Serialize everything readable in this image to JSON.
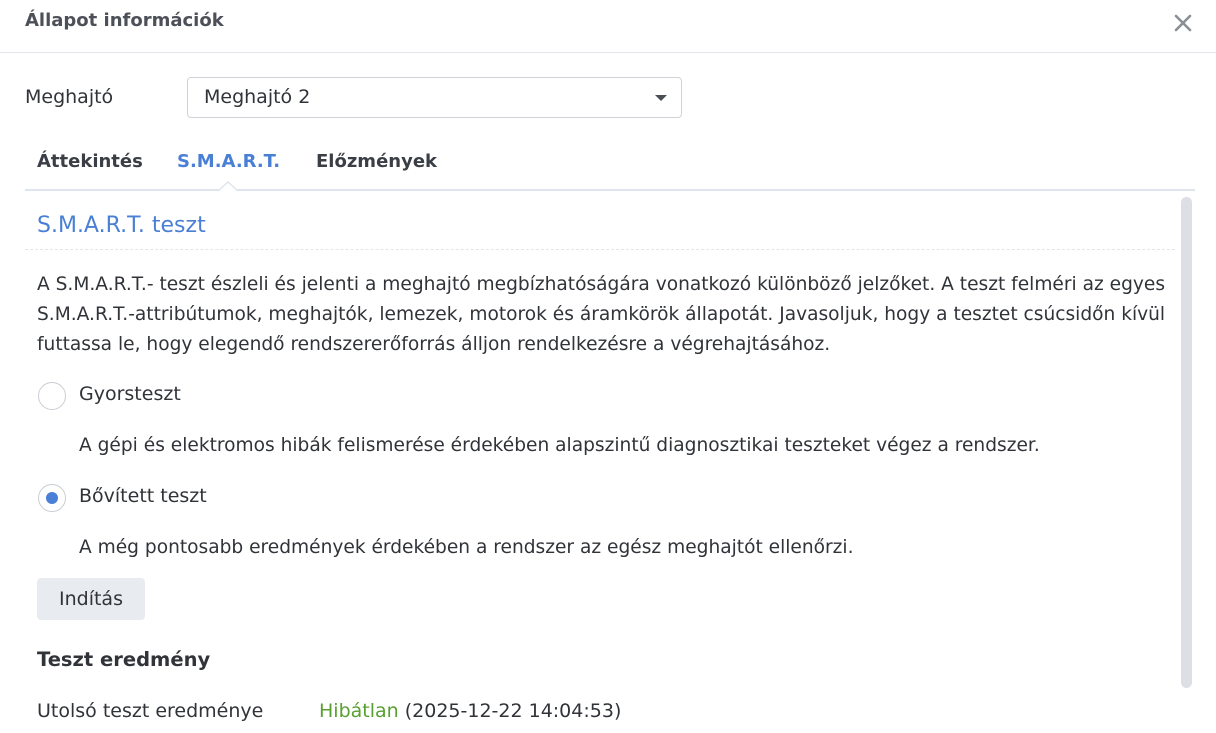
{
  "window": {
    "title": "Állapot információk",
    "close_icon": "close-icon"
  },
  "drive": {
    "label": "Meghajtó",
    "selected": "Meghajtó 2"
  },
  "tabs": [
    {
      "label": "Áttekintés",
      "active": false
    },
    {
      "label": "S.M.A.R.T.",
      "active": true
    },
    {
      "label": "Előzmények",
      "active": false
    }
  ],
  "smart": {
    "section_title": "S.M.A.R.T. teszt",
    "description": "A S.M.A.R.T.- teszt észleli és jelenti a meghajtó megbízhatóságára vonatkozó különböző jelzőket. A teszt felméri az egyes S.M.A.R.T.-attribútumok, meghajtók, lemezek, motorok és áramkörök állapotát. Javasoljuk, hogy a tesztet csúcsidőn kívül futtassa le, hogy elegendő rendszererőforrás álljon rendelkezésre a végrehajtásához.",
    "options": [
      {
        "label": "Gyorsteszt",
        "description": "A gépi és elektromos hibák felismerése érdekében alapszintű diagnosztikai teszteket végez a rendszer.",
        "checked": false
      },
      {
        "label": "Bővített teszt",
        "description": "A még pontosabb eredmények érdekében a rendszer az egész meghajtót ellenőrzi.",
        "checked": true
      }
    ],
    "start_label": "Indítás",
    "results": {
      "heading": "Teszt eredmény",
      "last_label": "Utolsó teszt eredménye",
      "status": "Hibátlan",
      "timestamp": "(2025-12-22 14:04:53)"
    }
  },
  "colors": {
    "accent": "#4a7fd6",
    "success": "#58a031",
    "text": "#303338"
  }
}
